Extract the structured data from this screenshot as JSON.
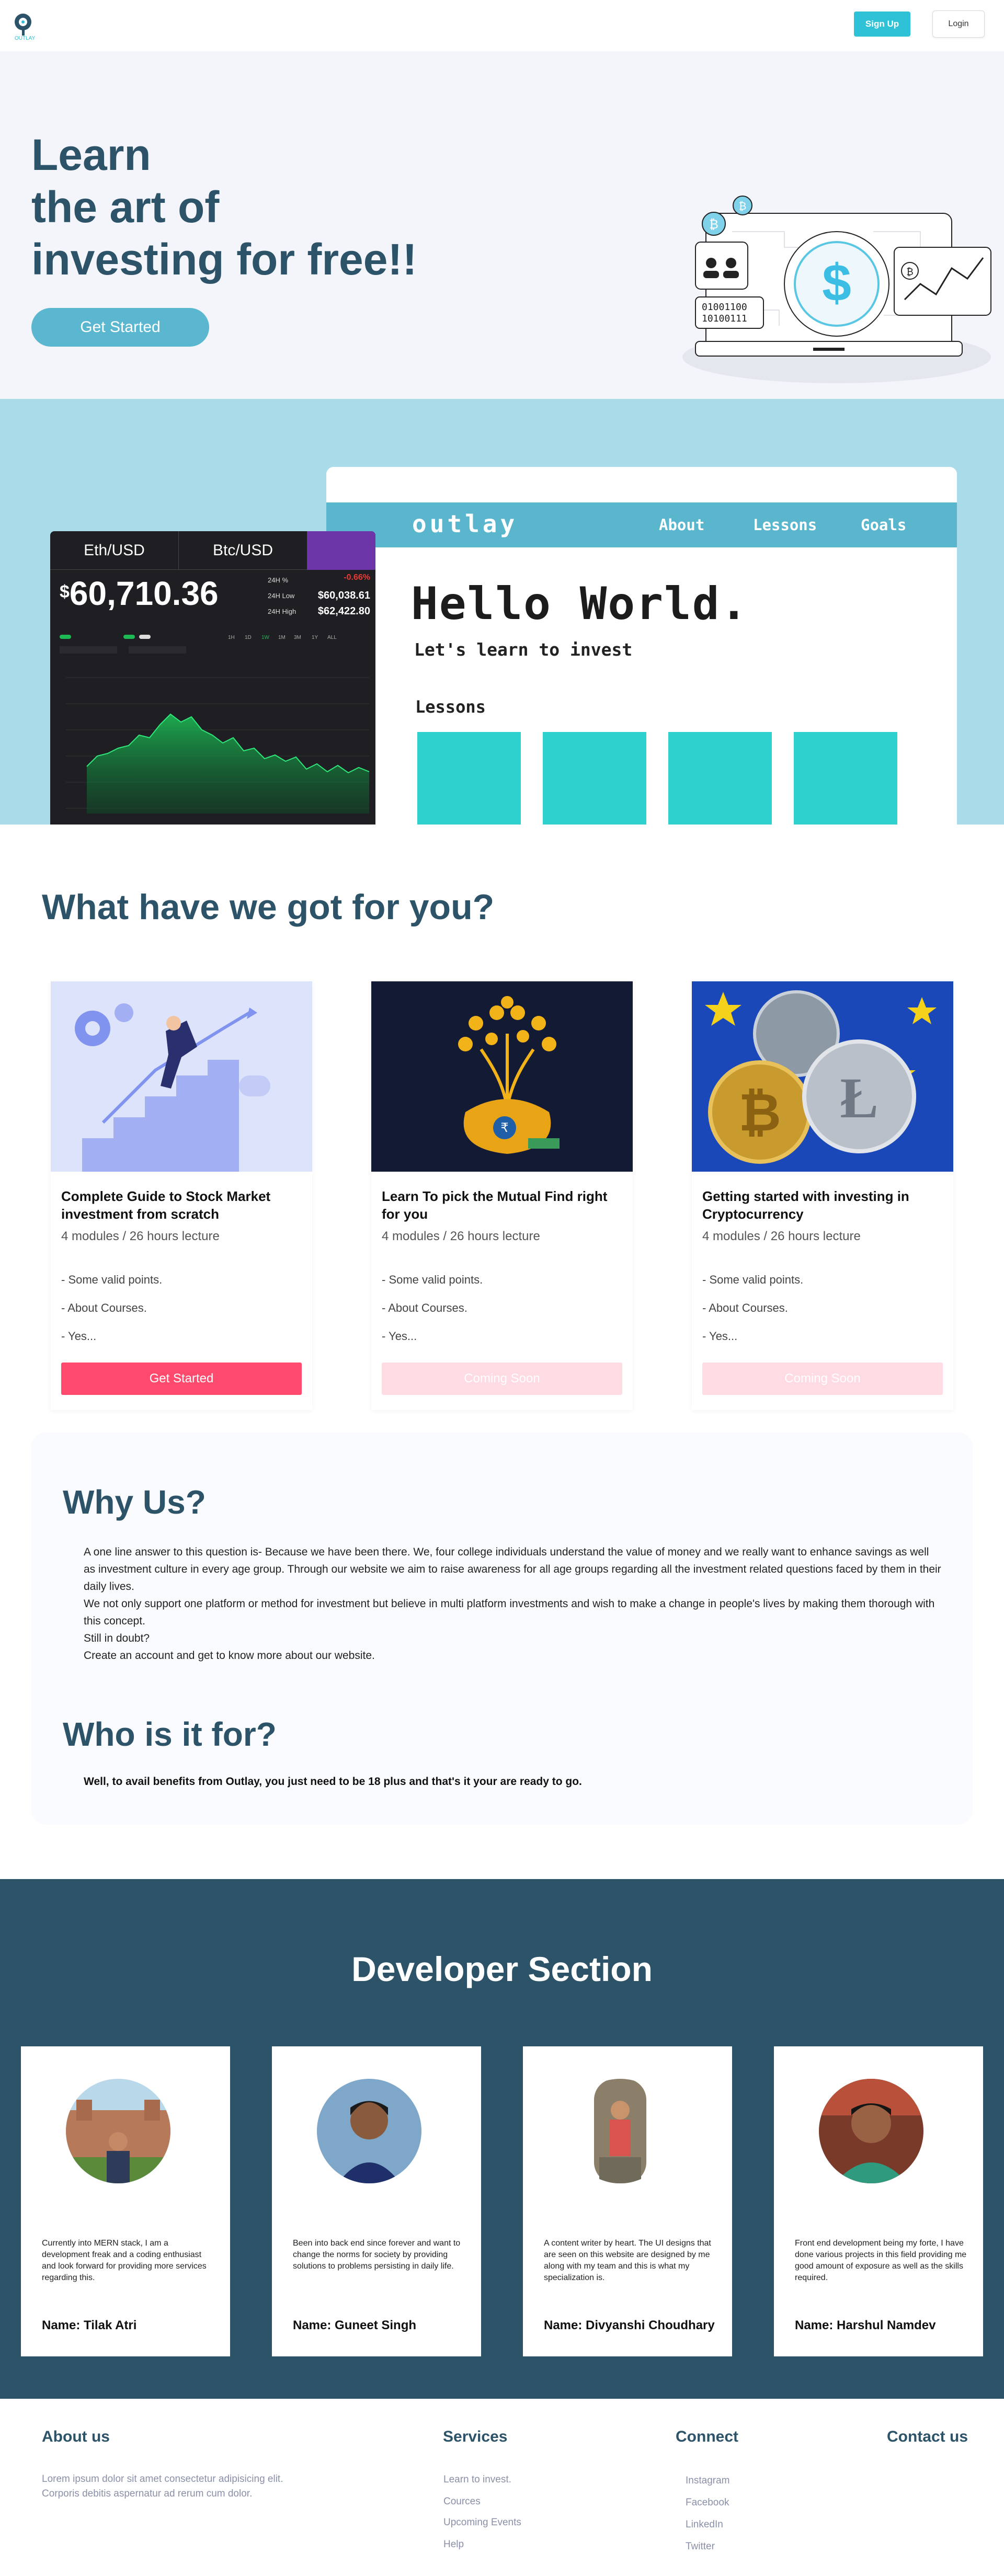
{
  "nav": {
    "logo_icon": "outlay-logo-icon",
    "signup_label": "Sign Up",
    "login_label": "Login"
  },
  "hero": {
    "title_lines": [
      "Learn",
      "the art of",
      "investing for free!!"
    ],
    "cta_label": "Get Started",
    "illustration_icon": "crypto-dashboard-illustration"
  },
  "preview": {
    "mock_site": {
      "brand": "outlay",
      "links": [
        "About",
        "Lessons",
        "Goals"
      ],
      "heading": "Hello World.",
      "subheading": "Let's learn to invest",
      "section_label": "Lessons"
    },
    "trading_widget": {
      "tabs": [
        "Eth/USD",
        "Btc/USD"
      ],
      "price_symbol": "$",
      "price": "60,710.36",
      "stats": [
        {
          "label": "24H %",
          "value": "-0.66%"
        },
        {
          "label": "24H Low",
          "value": "$60,038.61"
        },
        {
          "label": "24H High",
          "value": "$62,422.80"
        }
      ],
      "colors": {
        "accent": "#6c35a8",
        "up": "#1db954",
        "down": "#e53935"
      }
    }
  },
  "offerings": {
    "title": "What have we got for you?",
    "courses": [
      {
        "title": "Complete Guide to Stock Market investment from scratch",
        "meta": "4 modules / 26 hours lecture",
        "points": [
          "- Some valid points.",
          "- About Courses.",
          "- Yes..."
        ],
        "button": "Get Started",
        "button_state": "active",
        "image_icon": "stock-growth-illustration"
      },
      {
        "title": "Learn To pick the Mutual Find right for you",
        "meta": "4 modules / 26 hours lecture",
        "points": [
          "- Some valid points.",
          "- About Courses.",
          "- Yes..."
        ],
        "button": "Coming Soon",
        "button_state": "disabled",
        "image_icon": "money-tree-illustration"
      },
      {
        "title": "Getting started with investing in Cryptocurrency",
        "meta": "4 modules / 26 hours lecture",
        "points": [
          "- Some valid points.",
          "- About Courses.",
          "- Yes..."
        ],
        "button": "Coming Soon",
        "button_state": "disabled",
        "image_icon": "crypto-coins-photo"
      }
    ],
    "colors": {
      "active_button": "#ff4a6e",
      "disabled_button": "#ffdbe3"
    }
  },
  "why": {
    "title": "Why Us?",
    "paragraphs": [
      "A one line answer to this question is- Because we have been there. We, four college individuals understand the value of money and we really want to enhance savings as well as investment culture in every age group. Through our website we aim to raise awareness for all age groups regarding all the investment related questions faced by them in their daily lives.",
      "We not only support one platform or method for investment but believe in multi platform investments and wish to make a change in people's lives by making them thorough with this concept.",
      "Still in doubt?",
      "Create an account and get to know more about our website."
    ],
    "who_title": "Who is it for?",
    "who_text": "Well, to avail benefits from Outlay, you just need to be 18 plus and that's it your are ready to go."
  },
  "developers": {
    "title": "Developer Section",
    "members": [
      {
        "bio": "Currently into MERN stack, I am a development freak and a coding enthusiast and look forward for providing more services regarding this.",
        "name": "Name: Tilak Atri",
        "avatar_icon": "avatar-photo"
      },
      {
        "bio": "Been into back end since forever and want to change the norms for society by providing solutions to problems persisting in daily life.",
        "name": "Name: Guneet Singh",
        "avatar_icon": "avatar-photo"
      },
      {
        "bio": "A content writer by heart. The UI designs that are seen on this website are designed by me along with my team and this is what my specialization is.",
        "name": "Name: Divyanshi Choudhary",
        "avatar_icon": "avatar-photo"
      },
      {
        "bio": "Front end development being my forte, I have done various projects in this field providing me good amount of exposure as well as the skills required.",
        "name": "Name: Harshul Namdev",
        "avatar_icon": "avatar-photo"
      }
    ]
  },
  "footer": {
    "about_title": "About us",
    "about_text": "Lorem ipsum dolor sit amet consectetur adipisicing elit. Corporis debitis aspernatur ad rerum cum dolor.",
    "services_title": "Services",
    "services": [
      "Learn to invest.",
      "Cources",
      "Upcoming Events",
      "Help"
    ],
    "connect_title": "Connect",
    "connect": [
      "Instagram",
      "Facebook",
      "LinkedIn",
      "Twitter"
    ],
    "contact_title": "Contact us"
  }
}
